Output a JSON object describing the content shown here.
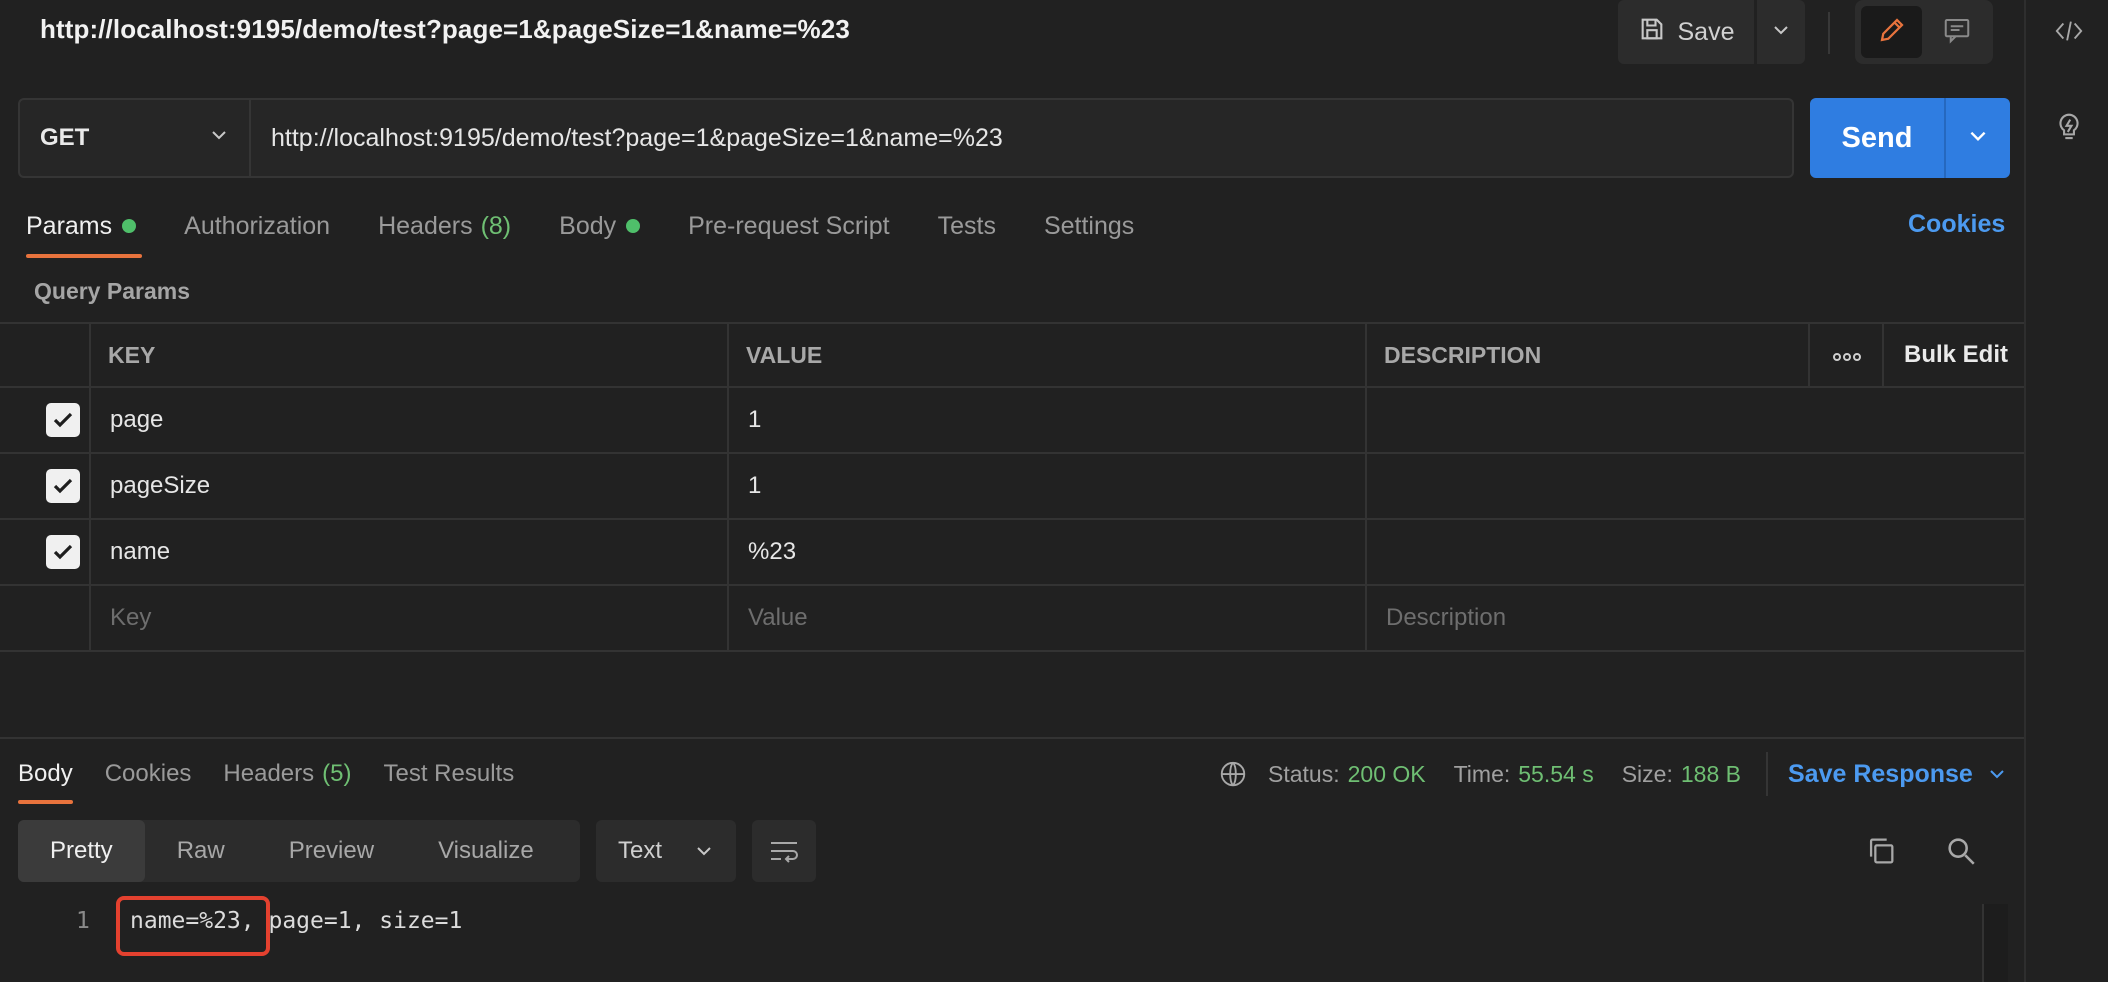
{
  "header": {
    "title": "http://localhost:9195/demo/test?page=1&pageSize=1&name=%23",
    "save_label": "Save"
  },
  "request": {
    "method": "GET",
    "url": "http://localhost:9195/demo/test?page=1&pageSize=1&name=%23",
    "send_label": "Send"
  },
  "tabs": {
    "params": "Params",
    "authorization": "Authorization",
    "headers": "Headers",
    "headers_count": "(8)",
    "body": "Body",
    "prerequest": "Pre-request Script",
    "tests": "Tests",
    "settings": "Settings",
    "cookies": "Cookies"
  },
  "params": {
    "section_label": "Query Params",
    "columns": {
      "key": "KEY",
      "value": "VALUE",
      "description": "DESCRIPTION",
      "more": "ooo",
      "bulk_edit": "Bulk Edit"
    },
    "rows": [
      {
        "key": "page",
        "value": "1",
        "description": "",
        "checked": true
      },
      {
        "key": "pageSize",
        "value": "1",
        "description": "",
        "checked": true
      },
      {
        "key": "name",
        "value": "%23",
        "description": "",
        "checked": true
      }
    ],
    "placeholders": {
      "key": "Key",
      "value": "Value",
      "description": "Description"
    }
  },
  "response": {
    "tabs": {
      "body": "Body",
      "cookies": "Cookies",
      "headers": "Headers",
      "headers_count": "(5)",
      "test_results": "Test Results"
    },
    "status_label": "Status:",
    "status_value": "200 OK",
    "time_label": "Time:",
    "time_value": "55.54 s",
    "size_label": "Size:",
    "size_value": "188 B",
    "save_response": "Save Response",
    "views": [
      "Pretty",
      "Raw",
      "Preview",
      "Visualize"
    ],
    "format": "Text",
    "lines": [
      {
        "number": "1",
        "text": "name=%23, page=1, size=1"
      }
    ]
  },
  "colors": {
    "accent_blue": "#2f7de1",
    "link_blue": "#4c9af0",
    "success_green": "#6fbf73",
    "active_tab_orange": "#e8733d",
    "highlight_red": "#e4412f"
  }
}
